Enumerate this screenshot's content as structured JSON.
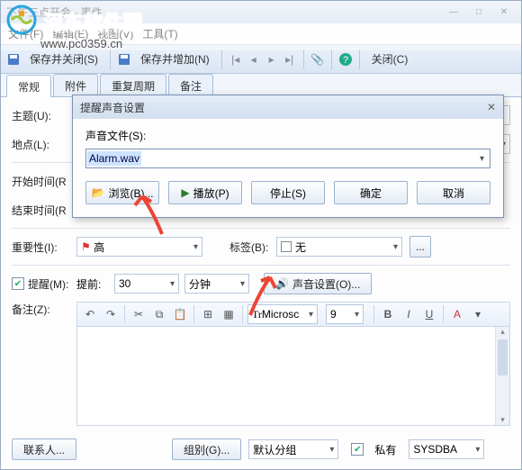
{
  "window_title": "下午三点开会 - 事件",
  "watermark": {
    "brand": "河东软件园",
    "url": "www.pc0359.cn"
  },
  "menubar": {
    "file": "文件(F)",
    "edit": "编辑(E)",
    "view": "视图(V)",
    "tool": "工具(T)"
  },
  "toolbar": {
    "save_close": "保存并关闭(S)",
    "save_add": "保存并增加(N)",
    "close": "关闭(C)"
  },
  "tabs": {
    "general": "常规",
    "attach": "附件",
    "recur": "重复周期",
    "note": "备注"
  },
  "form": {
    "subject_label": "主题(U):",
    "location_label": "地点(L):",
    "start_label": "开始时间(R",
    "end_label": "结束时间(R",
    "importance_label": "重要性(I):",
    "importance_value": "高",
    "tag_label": "标签(B):",
    "tag_value": "无",
    "remind_label": "提醒(M):",
    "ahead_label": "提前:",
    "ahead_value": "30",
    "ahead_unit": "分钟",
    "sound_btn": "声音设置(O)...",
    "memo_label": "备注(Z):"
  },
  "editor": {
    "font": "Microsc",
    "size": "9"
  },
  "bottom": {
    "contact": "联系人...",
    "group_btn": "组别(G)...",
    "group_value": "默认分组",
    "private": "私有",
    "user": "SYSDBA"
  },
  "dialog": {
    "title": "提醒声音设置",
    "field_label": "声音文件(S):",
    "field_value": "Alarm.wav",
    "browse": "浏览(B)...",
    "play": "播放(P)",
    "stop": "停止(S)",
    "ok": "确定",
    "cancel": "取消"
  }
}
